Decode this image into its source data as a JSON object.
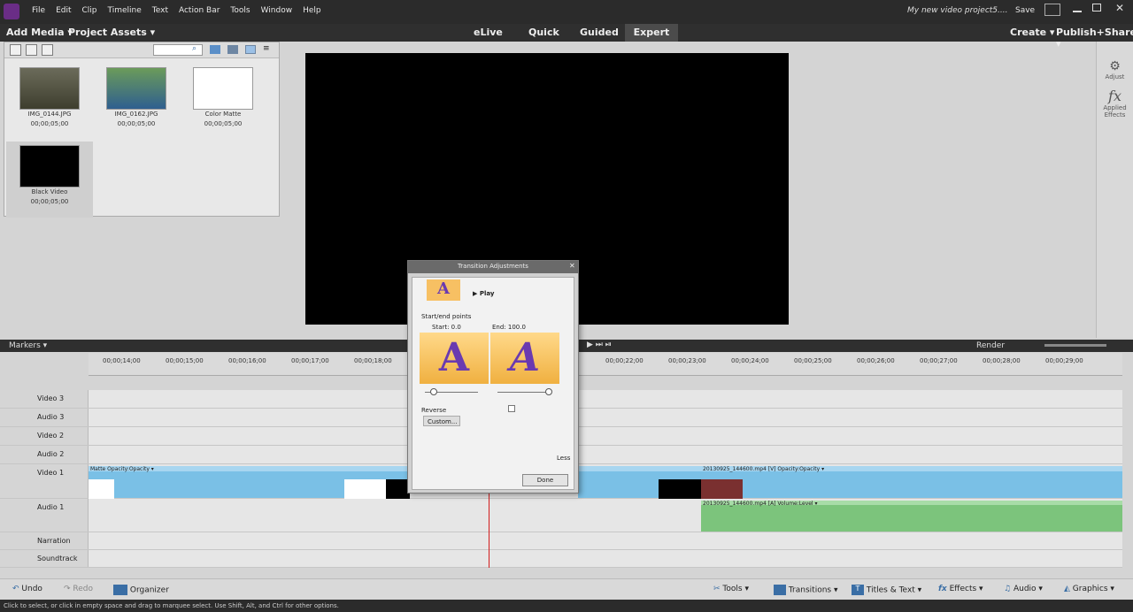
{
  "menu": [
    "File",
    "Edit",
    "Clip",
    "Timeline",
    "Text",
    "Action Bar",
    "Tools",
    "Window",
    "Help"
  ],
  "project_title": "My new video project5....",
  "save_label": "Save",
  "add_media": "Add Media ▾",
  "project_assets": "Project Assets ▾",
  "modes": [
    "eLive",
    "Quick",
    "Guided",
    "Expert"
  ],
  "create": "Create ▾",
  "publish": "Publish+Share ▾",
  "assets": [
    {
      "name": "IMG_0144.JPG",
      "dur": "00;00;05;00"
    },
    {
      "name": "IMG_0162.JPG",
      "dur": "00;00;05;00"
    },
    {
      "name": "Color Matte",
      "dur": "00;00;05;00"
    },
    {
      "name": "Black Video",
      "dur": "00;00;05;00"
    }
  ],
  "right": {
    "adjust": "Adjust",
    "effects": "Applied Effects"
  },
  "markers": "Markers ▾",
  "render": "Render",
  "ticks": [
    "00;00;14;00",
    "00;00;15;00",
    "00;00;16;00",
    "00;00;17;00",
    "00;00;18;00",
    "00;00;22;00",
    "00;00;23;00",
    "00;00;24;00",
    "00;00;25;00",
    "00;00;26;00",
    "00;00;27;00",
    "00;00;28;00",
    "00;00;29;00"
  ],
  "tracks": [
    "Video 3",
    "Audio 3",
    "Video 2",
    "Audio 2",
    "Video 1",
    "Audio 1",
    "Narration",
    "Soundtrack"
  ],
  "clip_labels": {
    "matte": "Matte  Opacity:Opacity ▾",
    "v1": "20130925_144600.mp4 [V]   Opacity:Opacity ▾",
    "a1": "20130925_144600.mp4 [A]   Volume:Level ▾"
  },
  "dialog": {
    "title": "Transition Adjustments",
    "play": "Play",
    "startend": "Start/end points",
    "start": "Start: 0.0",
    "end": "End: 100.0",
    "reverse": "Reverse",
    "custom": "Custom...",
    "less": "Less",
    "done": "Done"
  },
  "bottom": {
    "undo": "Undo",
    "redo": "Redo",
    "organizer": "Organizer",
    "tools": "Tools ▾",
    "transitions": "Transitions ▾",
    "titles": "Titles & Text ▾",
    "effects": "Effects ▾",
    "audio": "Audio ▾",
    "graphics": "Graphics ▾"
  },
  "status": "Click to select, or click in empty space and drag to marquee select. Use Shift, Alt, and Ctrl for other options."
}
